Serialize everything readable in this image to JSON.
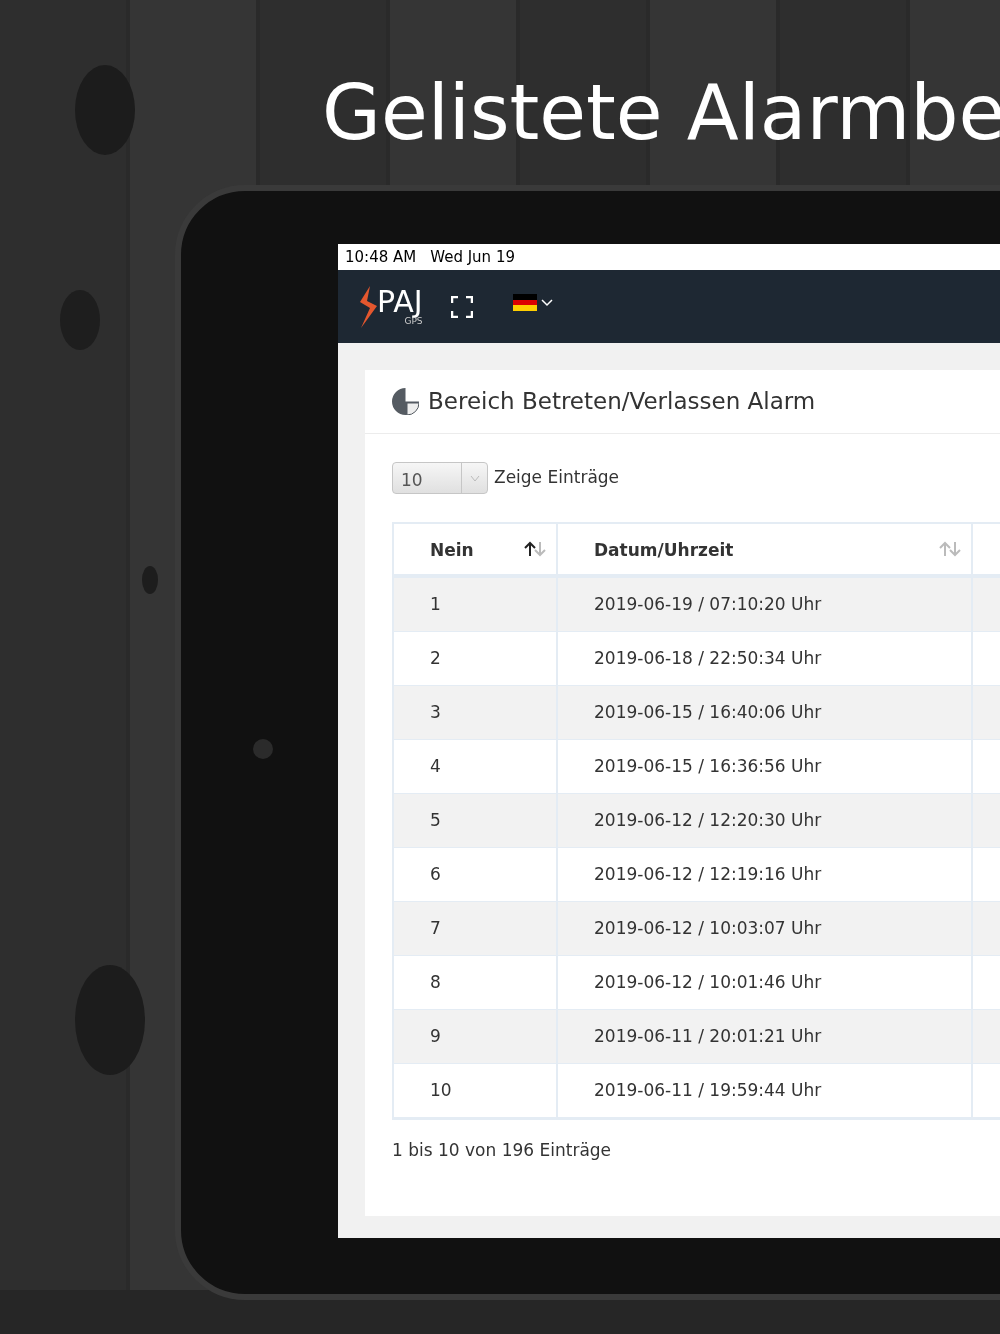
{
  "headline": "Gelistete Alarmbe",
  "status_bar": {
    "time": "10:48 AM",
    "date": "Wed Jun 19"
  },
  "navbar": {
    "logo": {
      "name": "PAJ",
      "sub": "GPS"
    }
  },
  "card": {
    "title": "Bereich Betreten/Verlassen Alarm",
    "length_select": {
      "value": "10",
      "label": "Zeige Einträge"
    },
    "table": {
      "columns": [
        {
          "label": "Nein",
          "sorted": true
        },
        {
          "label": "Datum/Uhrzeit",
          "sorted": false
        }
      ],
      "rows": [
        [
          "1",
          "2019-06-19 / 07:10:20 Uhr"
        ],
        [
          "2",
          "2019-06-18 / 22:50:34 Uhr"
        ],
        [
          "3",
          "2019-06-15 / 16:40:06 Uhr"
        ],
        [
          "4",
          "2019-06-15 / 16:36:56 Uhr"
        ],
        [
          "5",
          "2019-06-12 / 12:20:30 Uhr"
        ],
        [
          "6",
          "2019-06-12 / 12:19:16 Uhr"
        ],
        [
          "7",
          "2019-06-12 / 10:03:07 Uhr"
        ],
        [
          "8",
          "2019-06-12 / 10:01:46 Uhr"
        ],
        [
          "9",
          "2019-06-11 / 20:01:21 Uhr"
        ],
        [
          "10",
          "2019-06-11 / 19:59:44 Uhr"
        ]
      ]
    },
    "info": "1 bis 10 von 196 Einträge"
  }
}
